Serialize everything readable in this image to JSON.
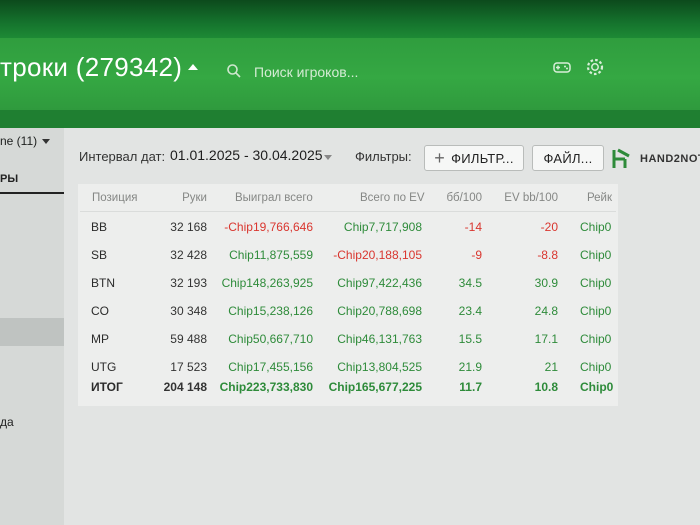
{
  "header": {
    "title": "троки (279342)",
    "search_placeholder": "Поиск игроков...",
    "icons": [
      "gamepad-icon",
      "gear-icon"
    ]
  },
  "sidebar": {
    "dropdown_label": "ne (11)",
    "tab_label": "РЫ",
    "text_fragment": "да"
  },
  "toolbar": {
    "interval_label": "Интервал дат:",
    "date_range": "01.01.2025 - 30.04.2025",
    "filters_label": "Фильтры:",
    "filter_button": "ФИЛЬТР...",
    "file_button": "ФАЙЛ...",
    "logo_text": "HAND2NOT"
  },
  "table": {
    "headers": [
      "Позиция",
      "Руки",
      "Выиграл всего",
      "Всего по EV",
      "бб/100",
      "EV bb/100",
      "Рейк"
    ],
    "rows": [
      {
        "pos": "BB",
        "hands": "32 168",
        "won": "-Chip19,766,646",
        "won_color": "red",
        "ev": "Chip7,717,908",
        "ev_color": "green",
        "bb": "-14",
        "bb_color": "red",
        "evbb": "-20",
        "evbb_color": "red",
        "rake": "Chip0"
      },
      {
        "pos": "SB",
        "hands": "32 428",
        "won": "Chip11,875,559",
        "won_color": "green",
        "ev": "-Chip20,188,105",
        "ev_color": "red",
        "bb": "-9",
        "bb_color": "red",
        "evbb": "-8.8",
        "evbb_color": "red",
        "rake": "Chip0"
      },
      {
        "pos": "BTN",
        "hands": "32 193",
        "won": "Chip148,263,925",
        "won_color": "green",
        "ev": "Chip97,422,436",
        "ev_color": "green",
        "bb": "34.5",
        "bb_color": "green",
        "evbb": "30.9",
        "evbb_color": "green",
        "rake": "Chip0"
      },
      {
        "pos": "CO",
        "hands": "30 348",
        "won": "Chip15,238,126",
        "won_color": "green",
        "ev": "Chip20,788,698",
        "ev_color": "green",
        "bb": "23.4",
        "bb_color": "green",
        "evbb": "24.8",
        "evbb_color": "green",
        "rake": "Chip0"
      },
      {
        "pos": "MP",
        "hands": "59 488",
        "won": "Chip50,667,710",
        "won_color": "green",
        "ev": "Chip46,131,763",
        "ev_color": "green",
        "bb": "15.5",
        "bb_color": "green",
        "evbb": "17.1",
        "evbb_color": "green",
        "rake": "Chip0"
      },
      {
        "pos": "UTG",
        "hands": "17 523",
        "won": "Chip17,455,156",
        "won_color": "green",
        "ev": "Chip13,804,525",
        "ev_color": "green",
        "bb": "21.9",
        "bb_color": "green",
        "evbb": "21",
        "evbb_color": "green",
        "rake": "Chip0"
      }
    ],
    "total": {
      "pos": "ИТОГ",
      "hands": "204 148",
      "won": "Chip223,733,830",
      "ev": "Chip165,677,225",
      "bb": "11.7",
      "evbb": "10.8",
      "rake": "Chip0"
    }
  },
  "colors": {
    "green": "#2e8b3a",
    "red": "#d9362f",
    "header_green": "#35a843"
  }
}
